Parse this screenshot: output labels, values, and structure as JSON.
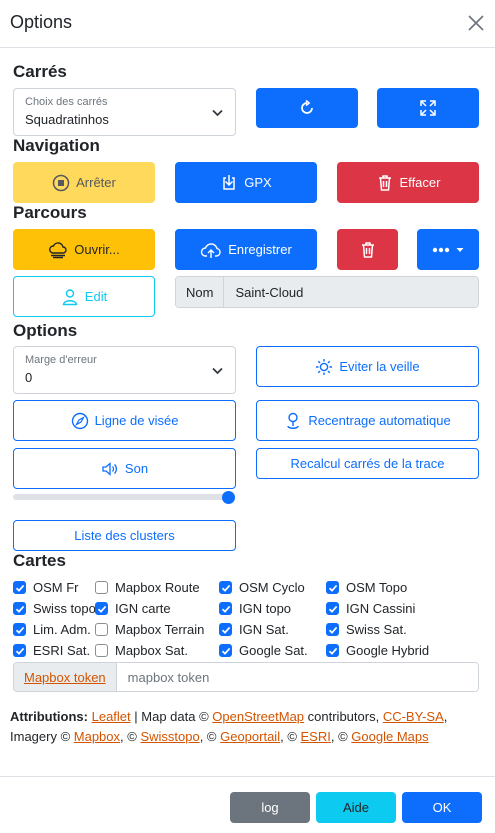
{
  "dialog": {
    "title": "Options"
  },
  "sections": {
    "carres": "Carrés",
    "navigation": "Navigation",
    "parcours": "Parcours",
    "options": "Options",
    "cartes": "Cartes"
  },
  "carres": {
    "select_label": "Choix des carrés",
    "select_value": "Squadratinhos"
  },
  "navigation": {
    "stop": "Arrêter",
    "gpx": "GPX",
    "clear": "Effacer"
  },
  "parcours": {
    "open": "Ouvrir...",
    "save": "Enregistrer",
    "edit": "Edit",
    "name_label": "Nom",
    "name_value": "Saint-Cloud"
  },
  "options": {
    "margin_label": "Marge d'erreur",
    "margin_value": "0",
    "wakelock": "Eviter la veille",
    "sightline": "Ligne de visée",
    "autocenter": "Recentrage automatique",
    "sound": "Son",
    "recalc": "Recalcul carrés de la trace",
    "clusters": "Liste des clusters",
    "sound_volume": 1.0
  },
  "maps": [
    {
      "label": "OSM Fr",
      "checked": true
    },
    {
      "label": "Mapbox Route",
      "checked": false
    },
    {
      "label": "OSM Cyclo",
      "checked": true
    },
    {
      "label": "OSM Topo",
      "checked": true
    },
    {
      "label": "Swiss topo",
      "checked": true
    },
    {
      "label": "IGN carte",
      "checked": true
    },
    {
      "label": "IGN topo",
      "checked": true
    },
    {
      "label": "IGN Cassini",
      "checked": true
    },
    {
      "label": "Lim. Adm.",
      "checked": true
    },
    {
      "label": "Mapbox Terrain",
      "checked": false
    },
    {
      "label": "IGN Sat.",
      "checked": true
    },
    {
      "label": "Swiss Sat.",
      "checked": true
    },
    {
      "label": "ESRI Sat.",
      "checked": true
    },
    {
      "label": "Mapbox Sat.",
      "checked": false
    },
    {
      "label": "Google Sat.",
      "checked": true
    },
    {
      "label": "Google Hybrid",
      "checked": true
    }
  ],
  "token": {
    "link": "Mapbox token",
    "placeholder": "mapbox token"
  },
  "attribution": {
    "lead": "Attributions:",
    "leaflet": "Leaflet",
    "t1": " | Map data © ",
    "osm": "OpenStreetMap",
    "t2": " contributors, ",
    "ccbysa": "CC-BY-SA",
    "t3": ", Imagery © ",
    "mapbox": "Mapbox",
    "t4": ", © ",
    "swisstopo": "Swisstopo",
    "t5": ", © ",
    "geoportail": "Geoportail",
    "t6": ", © ",
    "esri": "ESRI",
    "t7": ", © ",
    "google": "Google Maps"
  },
  "footer": {
    "log": "log",
    "help": "Aide",
    "ok": "OK"
  },
  "colors": {
    "primary": "#0d6efd",
    "danger": "#dc3545",
    "warning": "#ffc107",
    "info": "#0dcaf0",
    "secondary": "#6c757d",
    "link": "#d35400"
  }
}
